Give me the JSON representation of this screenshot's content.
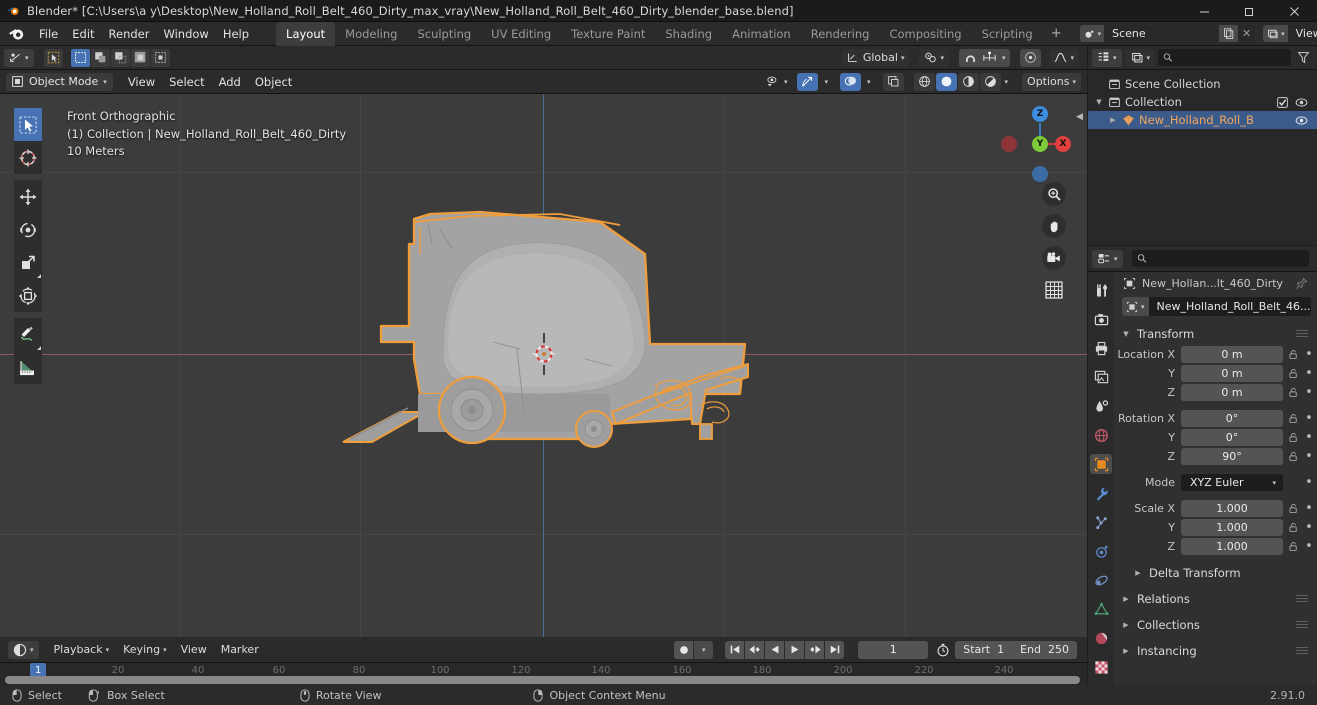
{
  "window": {
    "title": "Blender* [C:\\Users\\a y\\Desktop\\New_Holland_Roll_Belt_460_Dirty_max_vray\\New_Holland_Roll_Belt_460_Dirty_blender_base.blend]",
    "minimize": "—",
    "maximize": "❐",
    "close": "✕"
  },
  "topbar": {
    "menus": [
      "File",
      "Edit",
      "Render",
      "Window",
      "Help"
    ],
    "workspaces": [
      {
        "label": "Layout",
        "active": true
      },
      {
        "label": "Modeling",
        "active": false
      },
      {
        "label": "Sculpting",
        "active": false
      },
      {
        "label": "UV Editing",
        "active": false
      },
      {
        "label": "Texture Paint",
        "active": false
      },
      {
        "label": "Shading",
        "active": false
      },
      {
        "label": "Animation",
        "active": false
      },
      {
        "label": "Rendering",
        "active": false
      },
      {
        "label": "Compositing",
        "active": false
      },
      {
        "label": "Scripting",
        "active": false
      }
    ],
    "add_workspace": "+",
    "scene_name": "Scene",
    "view_layer_name": "View Layer"
  },
  "viewport_header": {
    "transform_orientation": "Global",
    "options": "Options"
  },
  "tool_header": {
    "mode": "Object Mode",
    "menus": [
      "View",
      "Select",
      "Add",
      "Object"
    ]
  },
  "viewport": {
    "view_name": "Front Orthographic",
    "collection_line": "(1) Collection | New_Holland_Roll_Belt_460_Dirty",
    "grid_scale": "10 Meters",
    "gizmo": {
      "z": "Z",
      "y": "Y",
      "x": "X"
    },
    "colors": {
      "bg": "#3c3c3c",
      "select_outline": "#f09d3c",
      "mesh": "#a3a3a3",
      "axis_z": "#4a6d96",
      "axis_x": "#8e5a5c"
    }
  },
  "outliner": {
    "search_placeholder": "",
    "rows": [
      {
        "label": "Scene Collection",
        "depth": 0,
        "icon": "collection-icon",
        "selected": false,
        "has_tri": false,
        "checkbox": false,
        "eye": false
      },
      {
        "label": "Collection",
        "depth": 1,
        "icon": "collection-icon",
        "selected": false,
        "has_tri": true,
        "tri": "▼",
        "checkbox": true,
        "eye": true
      },
      {
        "label": "New_Holland_Roll_B",
        "depth": 2,
        "icon": "mesh-icon",
        "selected": true,
        "has_tri": true,
        "tri": "▶",
        "checkbox": false,
        "eye": true
      }
    ]
  },
  "properties": {
    "breadcrumb_object": "New_Hollan...lt_460_Dirty",
    "id_name": "New_Holland_Roll_Belt_46...",
    "panels": {
      "transform": "Transform",
      "delta_transform": "Delta Transform",
      "relations": "Relations",
      "collections": "Collections",
      "instancing": "Instancing"
    },
    "transform_rows": [
      {
        "label": "Location X",
        "value": "0 m"
      },
      {
        "label": "Y",
        "value": "0 m"
      },
      {
        "label": "Z",
        "value": "0 m"
      },
      {
        "label": "Rotation X",
        "value": "0°"
      },
      {
        "label": "Y",
        "value": "0°"
      },
      {
        "label": "Z",
        "value": "90°"
      },
      {
        "label": "Scale X",
        "value": "1.000"
      },
      {
        "label": "Y",
        "value": "1.000"
      },
      {
        "label": "Z",
        "value": "1.000"
      }
    ],
    "mode_label": "Mode",
    "mode_value": "XYZ Euler"
  },
  "timeline": {
    "menus": [
      "Playback",
      "Keying",
      "View",
      "Marker"
    ],
    "current_frame": "1",
    "start_label": "Start",
    "start_value": "1",
    "end_label": "End",
    "end_value": "250",
    "ticks": [
      20,
      40,
      60,
      80,
      100,
      120,
      140,
      160,
      180,
      200,
      220,
      240
    ],
    "playhead_label": "1"
  },
  "statusbar": {
    "items": [
      {
        "label": "Select",
        "icon": "mouse-left-icon"
      },
      {
        "label": "Box Select",
        "icon": "mouse-left-drag-icon"
      },
      {
        "label": "Rotate View",
        "icon": "mouse-middle-icon"
      },
      {
        "label": "Object Context Menu",
        "icon": "mouse-right-icon"
      }
    ],
    "version": "2.91.0"
  }
}
